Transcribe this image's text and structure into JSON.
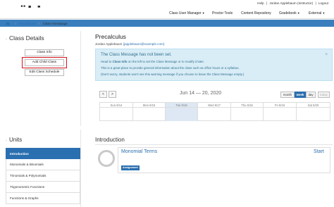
{
  "brand": {
    "logo_text": "möbius"
  },
  "user": {
    "help": "Help",
    "name": "Jordan Applebaum (Instructor)",
    "logout": "Logout",
    "separator": "|"
  },
  "nav": {
    "items": [
      {
        "label": "Class User Manager",
        "has_menu": true
      },
      {
        "label": "Proctor Tools",
        "has_menu": false
      },
      {
        "label": "Content Repository",
        "has_menu": false
      },
      {
        "label": "Gradebook",
        "has_menu": true
      },
      {
        "label": "External",
        "has_menu": true
      }
    ]
  },
  "breadcrumb": {
    "home_icon": "home-icon",
    "items": [
      "Precalculus",
      "Class Homepage"
    ],
    "separator": "/"
  },
  "class_details": {
    "title": "Class Details",
    "collapse_symbol": "-",
    "buttons": [
      "Class Info",
      "Add Child Class",
      "Edit Class Schedule"
    ]
  },
  "course": {
    "title": "Precalculus",
    "teacher_name": "Jordan Applebaum",
    "teacher_email": "(japplebaum@example.com)"
  },
  "alert": {
    "heading": "The Class Message has not been set.",
    "close": "×",
    "line1_pre": "Head to ",
    "line1_bold": "Class Info",
    "line1_post": " on the left to set the Class Message or to modify it later.",
    "line2": "This is a great place to provide general information about the class such as office hours or a syllabus.",
    "line3": "(Don't worry, students won't see this warning message if you choose to leave the Class Message empty.)"
  },
  "calendar": {
    "prev": "<",
    "next": ">",
    "range": "Jun 14 — 20, 2020",
    "views": [
      "month",
      "week",
      "day",
      "today"
    ],
    "active_view": "week",
    "days": [
      "Sun 6/14",
      "Mon 6/15",
      "Tue 6/16",
      "Wed 6/17",
      "Thu 6/18",
      "Fri 6/19",
      "Sat 6/20"
    ],
    "today_index": 2,
    "colors": {
      "today_bg": "#dde8f4",
      "accent": "#2a6fb0"
    }
  },
  "units": {
    "title": "Units",
    "collapse_symbol": "-",
    "items": [
      "Introduction",
      "Monomials & Binomials",
      "Trinomials & Polynomials",
      "Trigonometric Functions",
      "Functions & Graphs"
    ],
    "active_index": 0
  },
  "introduction": {
    "title": "Introduction",
    "module_title": "Monomial Terms",
    "start_label": "Start",
    "badge": "Assignment"
  },
  "colors": {
    "crumb_bar": "#3a7ebd",
    "highlight_box": "#d9141b",
    "alert_bg": "#d9edf7",
    "primary": "#2a6fb0"
  }
}
